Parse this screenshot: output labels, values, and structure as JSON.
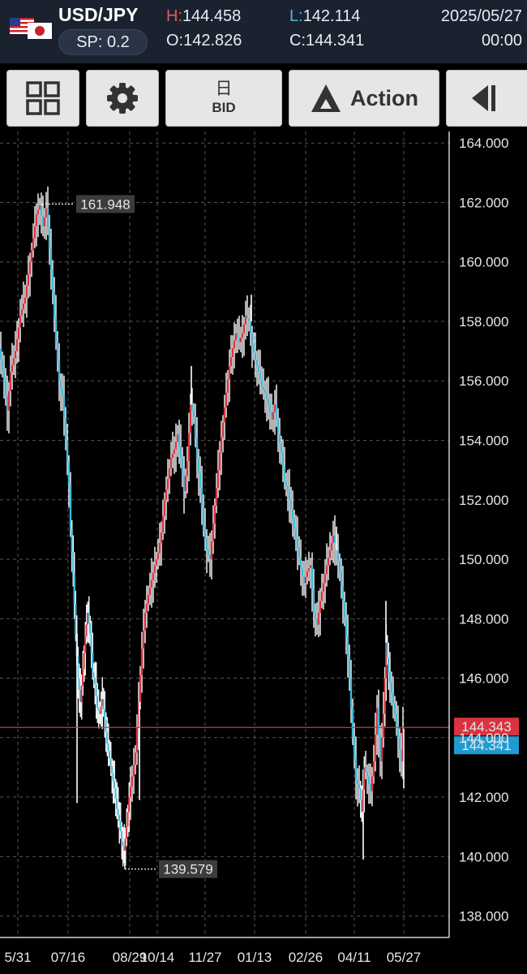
{
  "header": {
    "pair": "USD/JPY",
    "spread": "SP: 0.2",
    "high_label": "H:",
    "high_value": "144.458",
    "low_label": "L:",
    "low_value": "142.114",
    "open_label": "O:",
    "open_value": "142.826",
    "close_label": "C:",
    "close_value": "144.341",
    "date": "2025/05/27",
    "time": "00:00",
    "flag_icon": "us-jp-flag-icon"
  },
  "toolbar": {
    "grid_icon": "grid-icon",
    "settings_icon": "gear-icon",
    "timeframe_label": "日",
    "price_type_label": "BID",
    "action_label": "Action",
    "action_icon": "triangle-a-icon",
    "collapse_icon": "collapse-left-icon"
  },
  "colors": {
    "header_bg": "#1a2230",
    "up": "#d9333f",
    "down": "#3fb8dc",
    "wick": "#ffffff",
    "grid": "#555555",
    "ask_line": "#d9333f",
    "ask_badge": "#d9333f",
    "bid_badge": "#1f9bd1"
  },
  "chart_data": {
    "type": "candlestick",
    "y_ticks": [
      "164.000",
      "162.000",
      "160.000",
      "158.000",
      "156.000",
      "154.000",
      "152.000",
      "150.000",
      "148.000",
      "146.000",
      "144.000",
      "142.000",
      "140.000",
      "138.000"
    ],
    "ylim": [
      137.5,
      165.2
    ],
    "x_ticks": [
      "5/31",
      "07/16",
      "08/29",
      "10/14",
      "11/27",
      "01/13",
      "02/26",
      "04/11",
      "05/27"
    ],
    "grid": true,
    "current_ask": "144.343",
    "current_bid": "144.341",
    "max_label": "161.948",
    "min_label": "139.579",
    "price_path": [
      [
        -4,
        157.5
      ],
      [
        0,
        157.1
      ],
      [
        6,
        156.0
      ],
      [
        10,
        155.0
      ],
      [
        14,
        156.3
      ],
      [
        20,
        157.0
      ],
      [
        26,
        158.2
      ],
      [
        32,
        158.8
      ],
      [
        38,
        160.0
      ],
      [
        42,
        160.8
      ],
      [
        46,
        161.6
      ],
      [
        50,
        161.9
      ],
      [
        54,
        161.2
      ],
      [
        58,
        161.8
      ],
      [
        62,
        160.5
      ],
      [
        66,
        159.0
      ],
      [
        70,
        157.3
      ],
      [
        74,
        156.0
      ],
      [
        78,
        155.5
      ],
      [
        82,
        154.0
      ],
      [
        86,
        152.5
      ],
      [
        88,
        151.0
      ],
      [
        91,
        149.5
      ],
      [
        94,
        147.5
      ],
      [
        97,
        146.0
      ],
      [
        100,
        145.2
      ],
      [
        103,
        146.3
      ],
      [
        106,
        147.4
      ],
      [
        109,
        148.2
      ],
      [
        112,
        147.5
      ],
      [
        115,
        146.2
      ],
      [
        118,
        145.8
      ],
      [
        121,
        145.0
      ],
      [
        124,
        144.8
      ],
      [
        127,
        145.3
      ],
      [
        130,
        144.6
      ],
      [
        133,
        143.8
      ],
      [
        136,
        143.3
      ],
      [
        139,
        142.8
      ],
      [
        142,
        142.3
      ],
      [
        145,
        141.6
      ],
      [
        148,
        141.2
      ],
      [
        151,
        140.5
      ],
      [
        154,
        140.2
      ],
      [
        157,
        141.0
      ],
      [
        160,
        142.0
      ],
      [
        164,
        142.7
      ],
      [
        168,
        143.5
      ],
      [
        172,
        145.2
      ],
      [
        176,
        147.0
      ],
      [
        180,
        148.2
      ],
      [
        184,
        148.8
      ],
      [
        188,
        149.3
      ],
      [
        192,
        149.8
      ],
      [
        196,
        150.2
      ],
      [
        200,
        150.9
      ],
      [
        204,
        152.0
      ],
      [
        208,
        152.7
      ],
      [
        212,
        153.4
      ],
      [
        216,
        153.7
      ],
      [
        220,
        154.2
      ],
      [
        224,
        153.4
      ],
      [
        228,
        152.3
      ],
      [
        232,
        153.3
      ],
      [
        236,
        155.2
      ],
      [
        240,
        154.8
      ],
      [
        244,
        153.4
      ],
      [
        248,
        152.4
      ],
      [
        252,
        151.1
      ],
      [
        256,
        150.3
      ],
      [
        260,
        150.0
      ],
      [
        264,
        151.2
      ],
      [
        268,
        152.4
      ],
      [
        272,
        153.6
      ],
      [
        276,
        154.6
      ],
      [
        280,
        155.6
      ],
      [
        284,
        156.5
      ],
      [
        288,
        157.1
      ],
      [
        292,
        157.6
      ],
      [
        296,
        157.3
      ],
      [
        300,
        157.6
      ],
      [
        304,
        158.2
      ],
      [
        308,
        158.0
      ],
      [
        312,
        157.2
      ],
      [
        316,
        156.7
      ],
      [
        320,
        156.3
      ],
      [
        324,
        155.8
      ],
      [
        328,
        155.6
      ],
      [
        332,
        155.2
      ],
      [
        336,
        154.7
      ],
      [
        340,
        155.2
      ],
      [
        344,
        154.2
      ],
      [
        348,
        153.6
      ],
      [
        352,
        152.6
      ],
      [
        356,
        152.3
      ],
      [
        360,
        151.7
      ],
      [
        364,
        151.0
      ],
      [
        368,
        150.4
      ],
      [
        372,
        149.7
      ],
      [
        376,
        149.2
      ],
      [
        380,
        149.6
      ],
      [
        384,
        149.8
      ],
      [
        388,
        148.2
      ],
      [
        392,
        147.8
      ],
      [
        396,
        148.6
      ],
      [
        400,
        149.2
      ],
      [
        404,
        149.8
      ],
      [
        408,
        150.3
      ],
      [
        412,
        150.8
      ],
      [
        416,
        150.3
      ],
      [
        420,
        149.6
      ],
      [
        424,
        148.6
      ],
      [
        428,
        147.4
      ],
      [
        432,
        146.0
      ],
      [
        436,
        144.0
      ],
      [
        440,
        142.6
      ],
      [
        444,
        142.3
      ],
      [
        447,
        141.5
      ],
      [
        450,
        143.0
      ],
      [
        454,
        142.7
      ],
      [
        458,
        142.2
      ],
      [
        462,
        143.2
      ],
      [
        466,
        145.0
      ],
      [
        470,
        143.2
      ],
      [
        474,
        144.8
      ],
      [
        477,
        147.2
      ],
      [
        480,
        146.2
      ],
      [
        484,
        145.5
      ],
      [
        488,
        144.8
      ],
      [
        492,
        144.0
      ],
      [
        496,
        143.2
      ],
      [
        498,
        144.3
      ]
    ],
    "high_wicks": [
      [
        52,
        161.95
      ],
      [
        310,
        158.9
      ],
      [
        476,
        148.6
      ],
      [
        236,
        156.5
      ],
      [
        415,
        151.1
      ]
    ],
    "low_wicks": [
      [
        154,
        139.58
      ],
      [
        448,
        139.9
      ],
      [
        95,
        141.8
      ],
      [
        172,
        141.9
      ],
      [
        498,
        142.3
      ]
    ]
  }
}
